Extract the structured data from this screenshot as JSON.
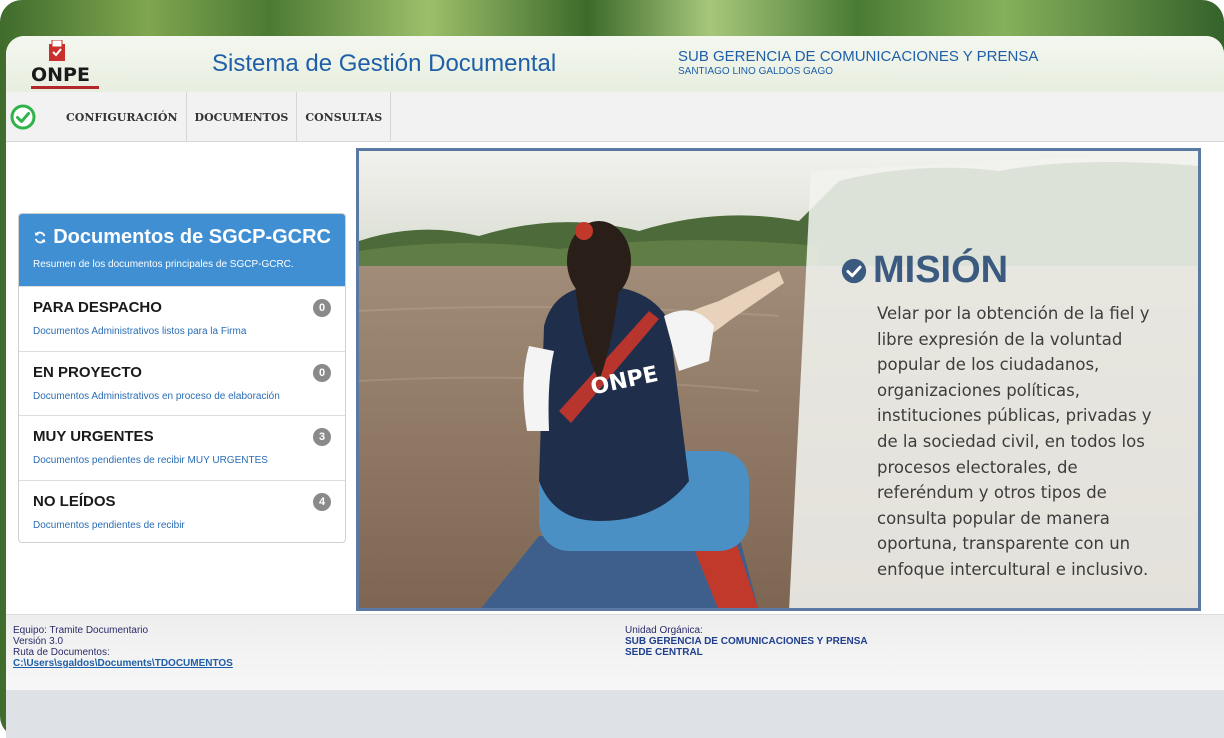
{
  "header": {
    "logo_text": "ONPE",
    "app_title": "Sistema de Gestión Documental",
    "unit_name": "SUB GERENCIA DE COMUNICACIONES Y PRENSA",
    "user_name": "SANTIAGO LINO GALDOS GAGO"
  },
  "nav": {
    "items": [
      {
        "label": "CONFIGURACIÓN"
      },
      {
        "label": "DOCUMENTOS"
      },
      {
        "label": "CONSULTAS"
      }
    ]
  },
  "panel": {
    "title": "Documentos de SGCP-GCRC",
    "subtitle": "Resumen de los documentos principales de SGCP-GCRC.",
    "items": [
      {
        "title": "PARA DESPACHO",
        "desc": "Documentos Administrativos listos para la Firma",
        "count": "0"
      },
      {
        "title": "EN PROYECTO",
        "desc": "Documentos Administrativos en proceso de elaboración",
        "count": "0"
      },
      {
        "title": "MUY URGENTES",
        "desc": "Documentos pendientes de recibir MUY URGENTES",
        "count": "3"
      },
      {
        "title": "NO LEÍDOS",
        "desc": "Documentos pendientes de recibir",
        "count": "4"
      }
    ]
  },
  "hero": {
    "vest_text": "ONPE",
    "mision_title": "MISIÓN",
    "mision_lines": [
      "Velar por la obtención de la fiel y",
      "libre expresión de la voluntad",
      "popular de los ciudadanos,",
      "organizaciones políticas,",
      "instituciones públicas, privadas y",
      "de la sociedad civil, en todos los",
      "procesos electorales, de",
      "referéndum y otros tipos de",
      "consulta popular de manera",
      "oportuna, transparente con un",
      "enfoque intercultural e inclusivo."
    ]
  },
  "footer": {
    "equipo": "Equipo: Tramite Documentario",
    "version": "Versión 3.0",
    "ruta_label": "Ruta de Documentos:",
    "ruta_path": "C:\\Users\\sgaldos\\Documents\\TDOCUMENTOS",
    "unidad_label": "Unidad Orgánica:",
    "unidad_name": "SUB GERENCIA DE COMUNICACIONES Y PRENSA",
    "sede": "SEDE CENTRAL"
  },
  "colors": {
    "accent_blue": "#3f8fd2",
    "title_blue": "#1f5fa9",
    "check_green": "#2fb34a",
    "mision_blue": "#3a5a80"
  },
  "icons": {
    "nav_status": "check-circle-icon",
    "panel_title": "refresh-icon",
    "mision": "check-circle-icon"
  }
}
